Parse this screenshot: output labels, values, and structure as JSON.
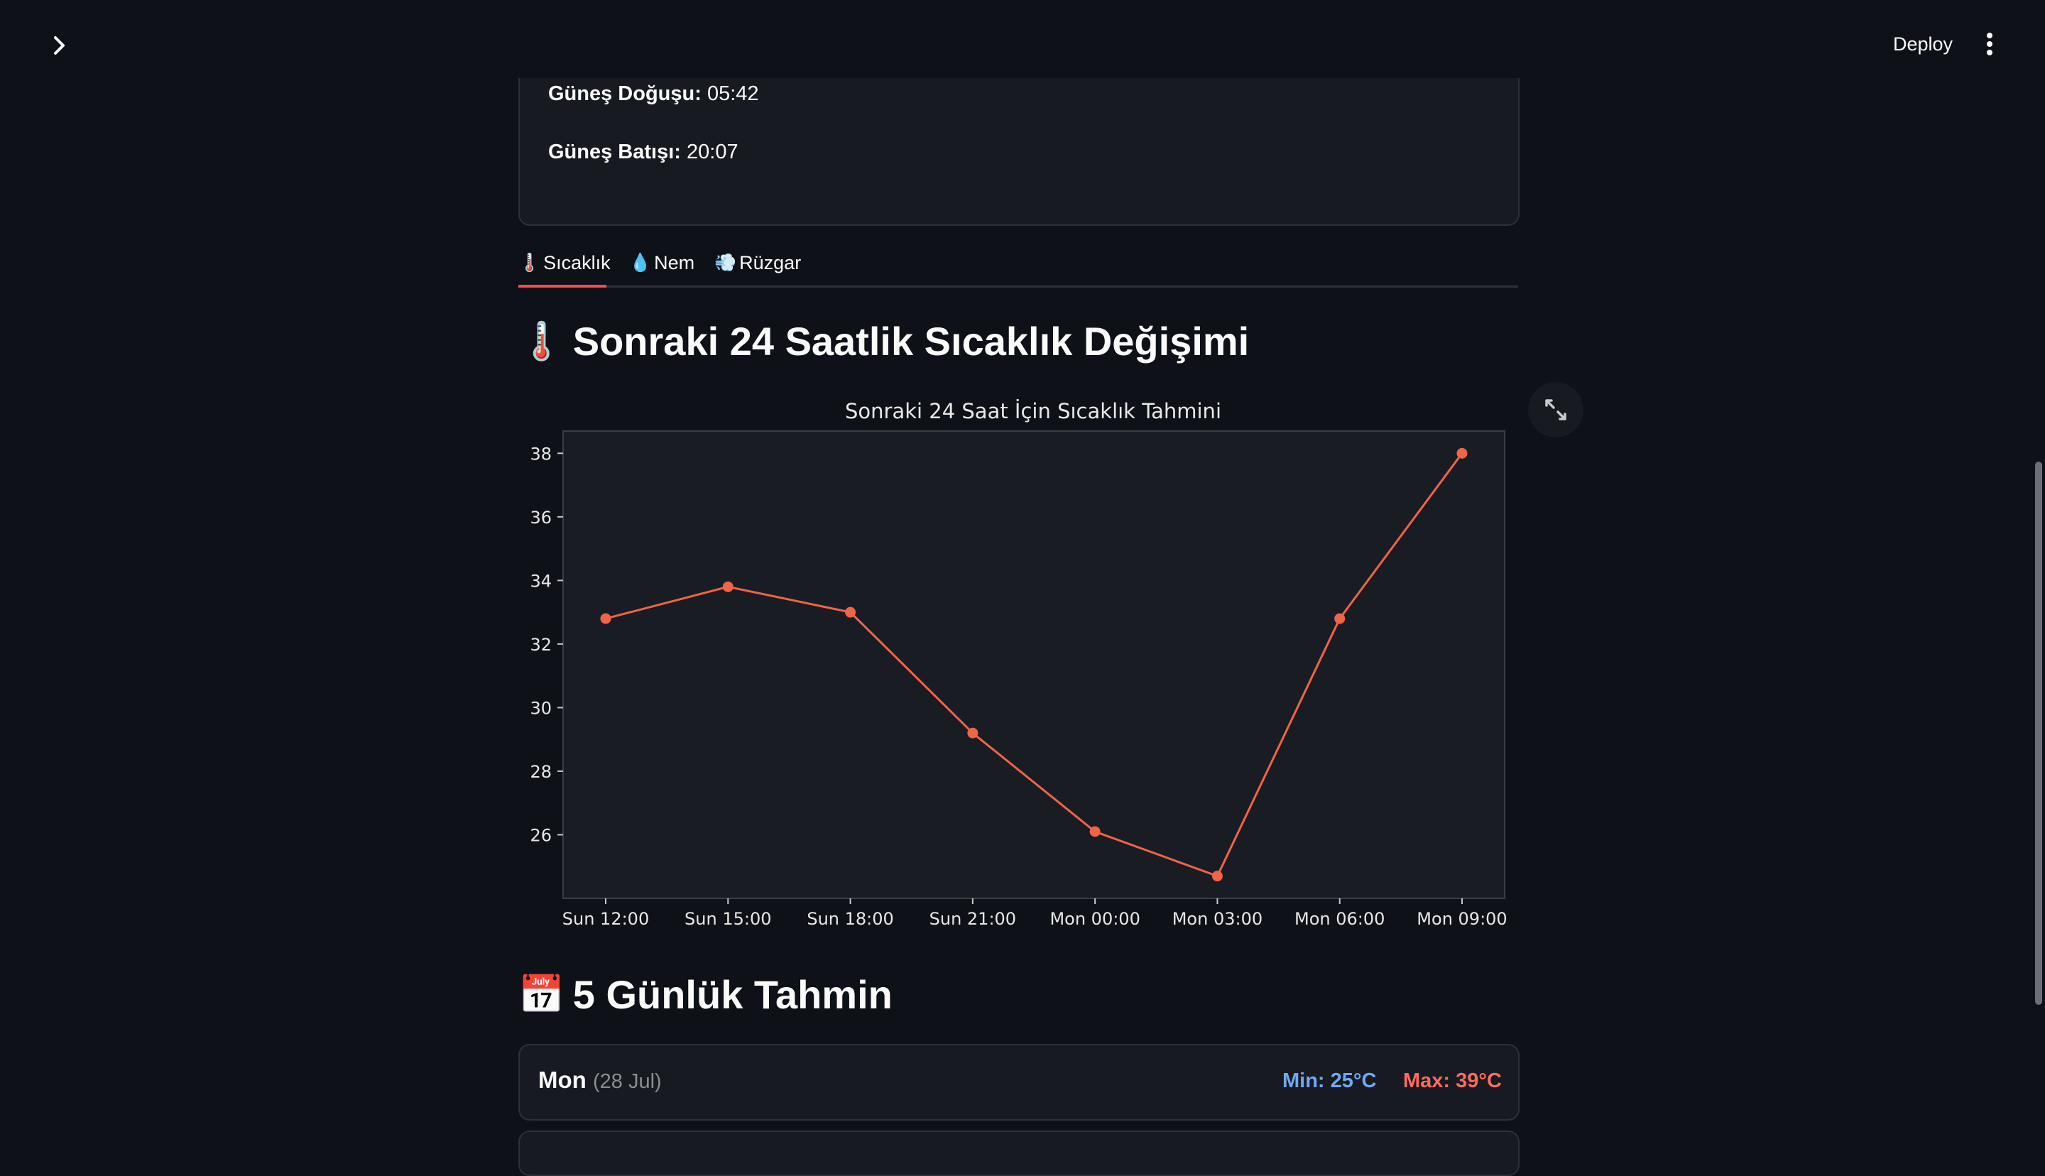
{
  "header": {
    "deploy_label": "Deploy"
  },
  "sun_info": {
    "sunrise_label": "Güneş Doğuşu:",
    "sunrise_value": "05:42",
    "sunset_label": "Güneş Batışı:",
    "sunset_value": "20:07"
  },
  "tabs": [
    {
      "icon": "🌡️",
      "label": "Sıcaklık"
    },
    {
      "icon": "💧",
      "label": "Nem"
    },
    {
      "icon": "💨",
      "label": "Rüzgar"
    }
  ],
  "temperature_section": {
    "emoji": "🌡️",
    "heading": "Sonraki 24 Saatlik Sıcaklık Değişimi"
  },
  "chart_data": {
    "type": "line",
    "title": "Sonraki 24 Saat İçin Sıcaklık Tahmini",
    "xlabel": "",
    "ylabel": "",
    "categories": [
      "Sun 12:00",
      "Sun 15:00",
      "Sun 18:00",
      "Sun 21:00",
      "Mon 00:00",
      "Mon 03:00",
      "Mon 06:00",
      "Mon 09:00"
    ],
    "values": [
      32.8,
      33.8,
      33.0,
      29.2,
      26.1,
      24.7,
      32.8,
      38.0
    ],
    "yticks": [
      26,
      28,
      30,
      32,
      34,
      36,
      38
    ],
    "ylim": [
      24.0,
      38.7
    ],
    "grid": false,
    "line_color": "#f06448"
  },
  "forecast_section": {
    "emoji": "📅",
    "heading": "5 Günlük Tahmin"
  },
  "forecast": [
    {
      "day": "Mon",
      "date": "(28 Jul)",
      "min": "Min: 25°C",
      "max": "Max: 39°C"
    }
  ]
}
